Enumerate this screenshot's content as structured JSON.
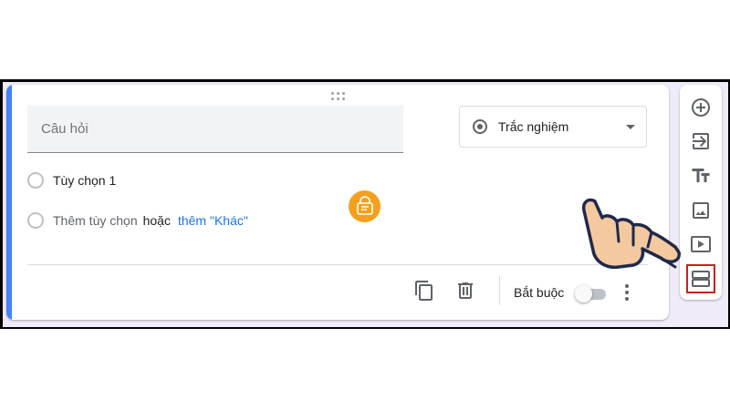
{
  "question": {
    "placeholder": "Câu hỏi"
  },
  "type_dropdown": {
    "selected": "Trắc nghiệm"
  },
  "options": {
    "option1": "Tùy chọn 1",
    "add_option": "Thêm tùy chọn",
    "or": "hoặc",
    "add_other": "thêm \"Khác\""
  },
  "footer": {
    "required_label": "Bắt buộc",
    "required_on": false
  },
  "sidebar": {
    "items": [
      {
        "icon": "add-circle-icon"
      },
      {
        "icon": "import-questions-icon"
      },
      {
        "icon": "title-text-icon"
      },
      {
        "icon": "image-icon"
      },
      {
        "icon": "video-icon"
      },
      {
        "icon": "add-section-icon"
      }
    ]
  },
  "colors": {
    "accent": "#4285f4",
    "link": "#1a73e8",
    "highlight": "#c5221f",
    "background": "#f0ebf8"
  }
}
